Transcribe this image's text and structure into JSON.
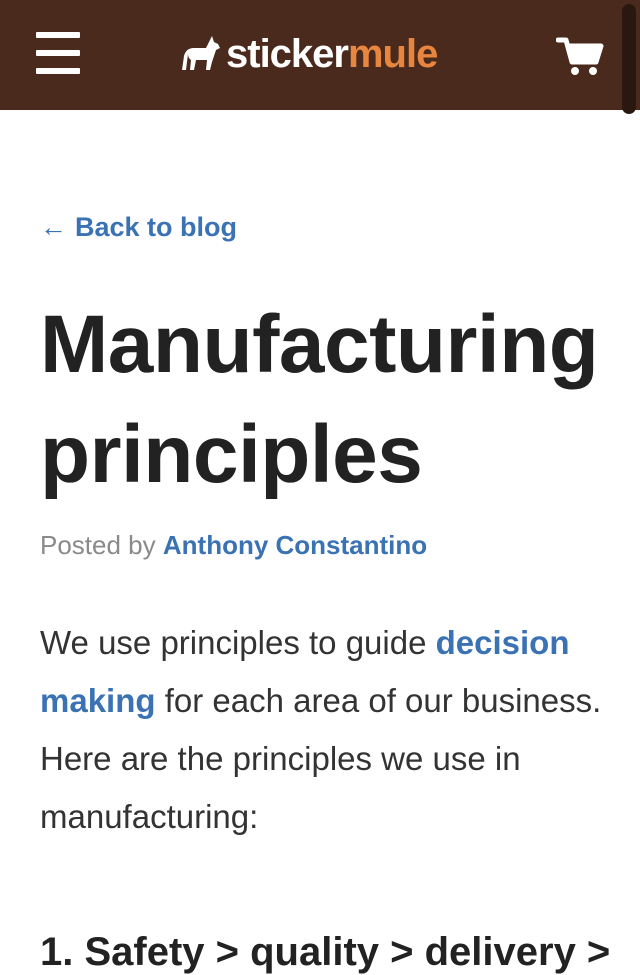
{
  "header": {
    "brand_part1": "sticker",
    "brand_part2": "mule",
    "background_color": "#4a2a1c",
    "accent_color": "#e8853e",
    "menu_icon": "hamburger-menu-icon",
    "cart_icon": "shopping-cart-icon"
  },
  "article": {
    "back_link": "Back to blog",
    "back_arrow": "←",
    "title": "Manufacturing principles",
    "byline_prefix": "Posted by",
    "author": "Anthony Constantino",
    "intro_before": "We use principles to guide",
    "intro_link": "decision making",
    "intro_after": "for each area of our business. Here are the principles we use in manufacturing:",
    "next_heading": "1. Safety > quality > delivery >"
  },
  "colors": {
    "link": "#3a72b3",
    "text": "#333333",
    "heading": "#222222",
    "muted": "#8a8a8a"
  }
}
